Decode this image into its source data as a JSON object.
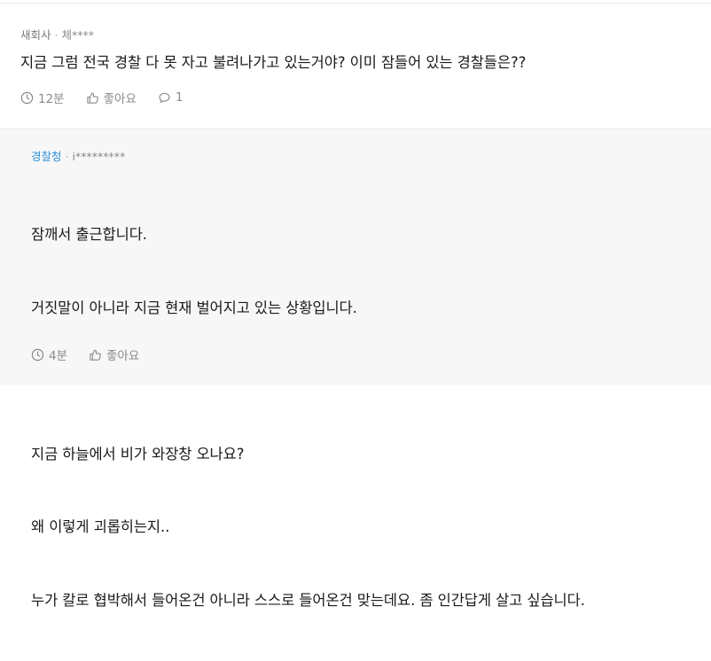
{
  "comment": {
    "author": "새회사",
    "separator": "·",
    "user_id": "체****",
    "text": "지금 그럼 전국 경찰 다 못 자고 불려나가고 있는거야? 이미 잠들어 있는 경찰들은??",
    "time": "12분",
    "like_label": "좋아요",
    "reply_count": "1"
  },
  "reply": {
    "author": "경찰청",
    "separator": "·",
    "user_id": "i*********",
    "lines": [
      "잠깨서 출근합니다.",
      "거짓말이 아니라 지금 현재 벌어지고 있는 상황입니다.",
      "",
      "지금 하늘에서 비가 와장창 오나요?",
      "왜 이렇게 괴롭히는지..",
      "누가 칼로 협박해서 들어온건 아니라 스스로 들어온건 맞는데요. 좀 인간답게 살고 싶습니다."
    ],
    "time": "4분",
    "like_label": "좋아요"
  },
  "colors": {
    "official_author": "#2d8fd8",
    "meta_gray": "#8a8a8a",
    "reply_bg": "#f7f7f7"
  }
}
